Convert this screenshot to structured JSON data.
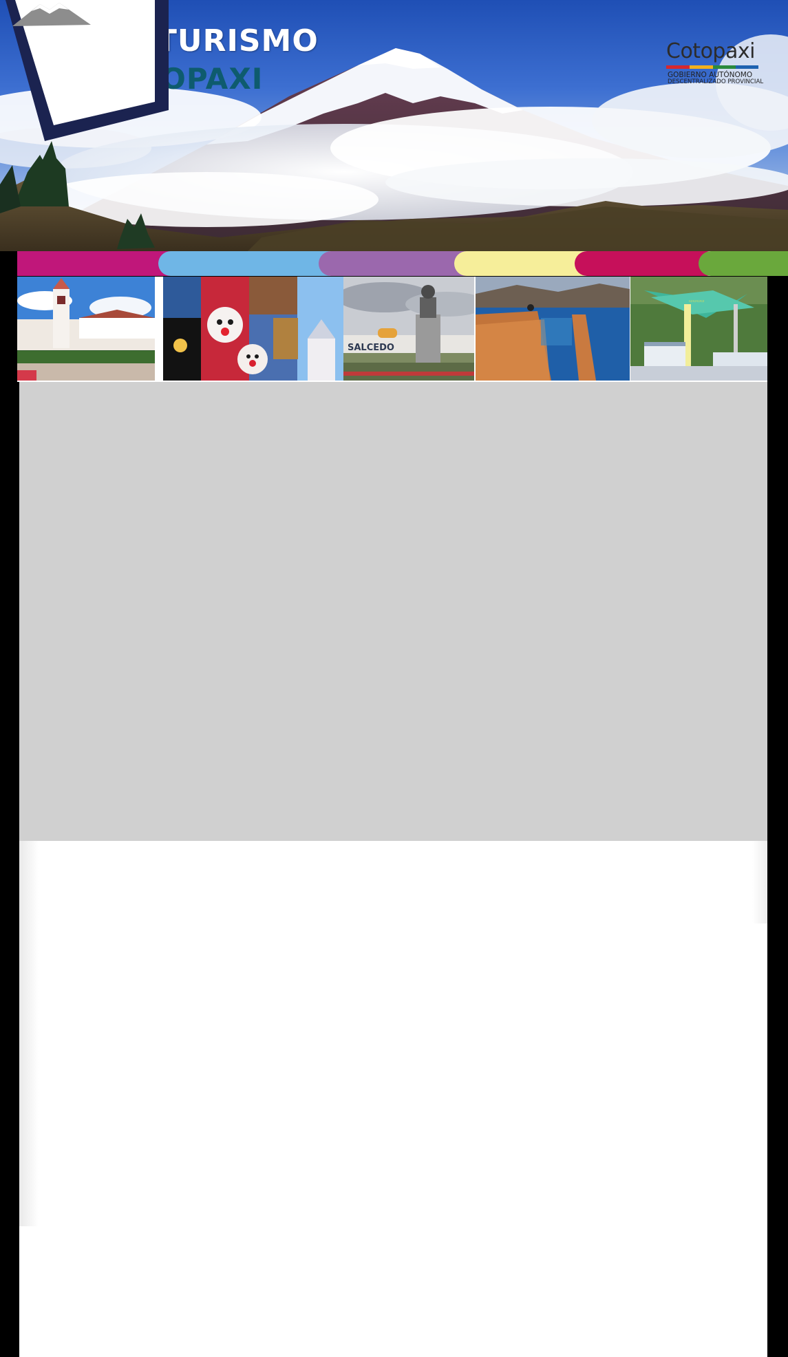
{
  "hero": {
    "title_line1": "VIVE TURISMO",
    "title_line2": "COTOPAXI",
    "title_line1_color": "#ffffff",
    "title_line2_color": "#0e5b6e",
    "scene": "snow-capped-volcano-with-clouds"
  },
  "logo": {
    "name": "Cotopaxi",
    "subtitle_line1": "GOBIERNO AUTÓNOMO",
    "subtitle_line2": "DESCENTRALIZADO PROVINCIAL",
    "frame_color": "#1b2350",
    "letter_colors": [
      "#d6282f",
      "#f2b01e",
      "#2a8a3e",
      "#1e62b0"
    ]
  },
  "color_band": {
    "colors": [
      "#c0177a",
      "#6fb6e6",
      "#9b68ad",
      "#f6ee9a",
      "#c6105a",
      "#6aa83c"
    ]
  },
  "gallery": {
    "photos": [
      {
        "name": "church-plaza-photo",
        "description_icon": "church-icon"
      },
      {
        "name": "festival-masks-collage",
        "description_icon": "mask-icon"
      },
      {
        "name": "salcedo-monument-photo",
        "caption": "SALCEDO",
        "description_icon": "monument-icon"
      },
      {
        "name": "quilotoa-lagoon-viewpoint-photo",
        "description_icon": "lake-icon"
      },
      {
        "name": "cable-car-photo",
        "description_icon": "cable-car-icon"
      }
    ]
  },
  "content": {
    "panel_gray_color": "#d0d0d0",
    "panel_white_color": "#ffffff"
  }
}
